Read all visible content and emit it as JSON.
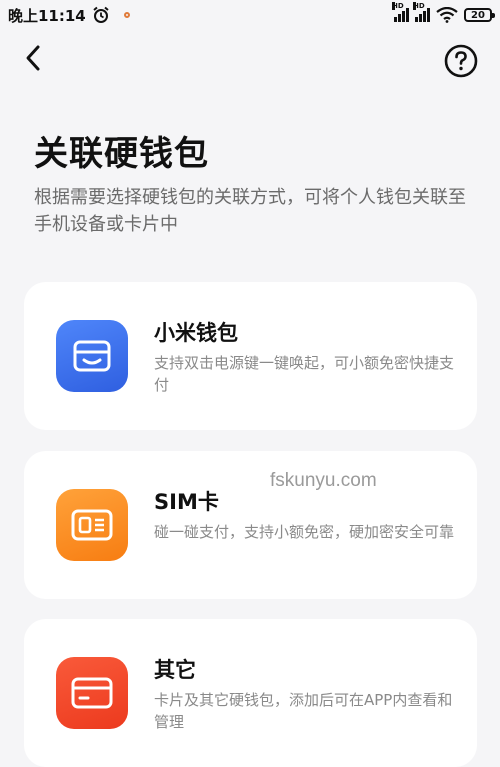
{
  "status_bar": {
    "time": "晚上11:14",
    "signal1_label": "HD",
    "signal2_label": "HD",
    "battery": "20"
  },
  "page": {
    "title": "关联硬钱包",
    "description": "根据需要选择硬钱包的关联方式，可将个人钱包关联至手机设备或卡片中"
  },
  "options": [
    {
      "title": "小米钱包",
      "description": "支持双击电源键一键唤起，可小额免密快捷支付",
      "color": "#3d72f0",
      "icon": "wallet-icon"
    },
    {
      "title": "SIM卡",
      "description": "碰一碰支付，支持小额免密，硬加密安全可靠",
      "color": "#fb8a1a",
      "icon": "sim-card-icon"
    },
    {
      "title": "其它",
      "description": "卡片及其它硬钱包，添加后可在APP内查看和管理",
      "color": "#f4472a",
      "icon": "card-icon"
    }
  ],
  "watermark": "fskunyu.com"
}
